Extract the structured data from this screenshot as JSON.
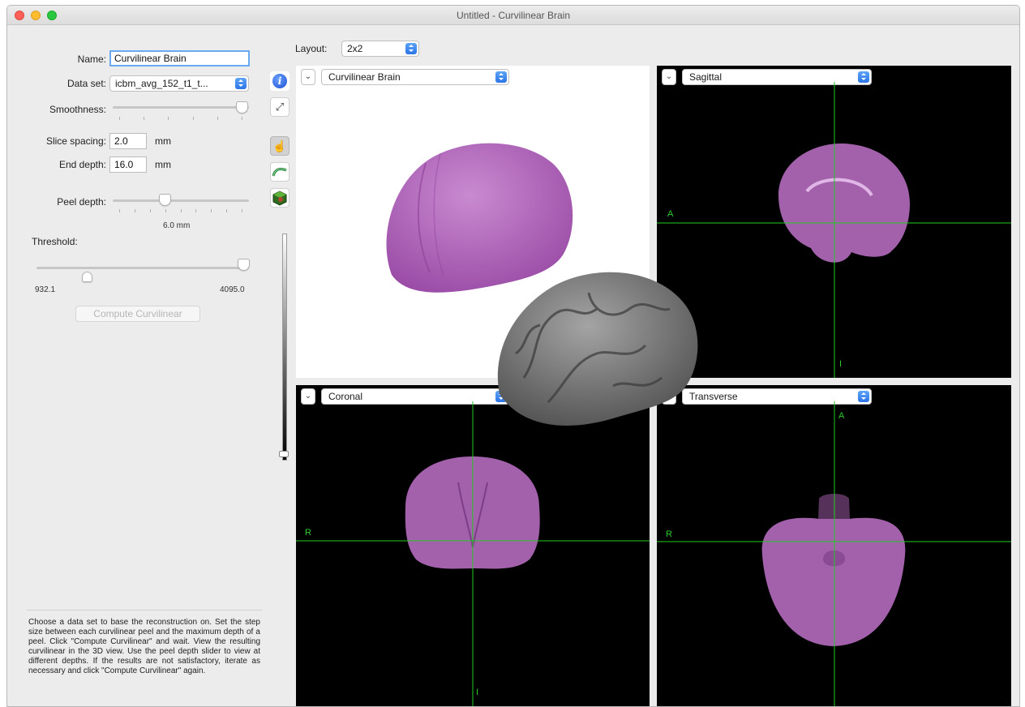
{
  "window": {
    "title": "Untitled - Curvilinear Brain"
  },
  "form": {
    "name_label": "Name:",
    "name_value": "Curvilinear Brain",
    "dataset_label": "Data set:",
    "dataset_value": "icbm_avg_152_t1_t...",
    "smoothness_label": "Smoothness:",
    "smoothness_level": 1.0,
    "slice_spacing_label": "Slice spacing:",
    "slice_spacing_value": "2.0",
    "slice_spacing_unit": "mm",
    "end_depth_label": "End depth:",
    "end_depth_value": "16.0",
    "end_depth_unit": "mm",
    "peel_depth_label": "Peel depth:",
    "peel_depth_value": "6.0 mm",
    "threshold_label": "Threshold:",
    "threshold_min": "932.1",
    "threshold_max": "4095.0",
    "compute_button": "Compute Curvilinear",
    "help_text": "Choose a data set to base the reconstruction on. Set the step size between each curvilinear peel and the maximum depth of a peel. Click \"Compute Curvilinear\" and wait. View the resulting curvilinear in the 3D view. Use the peel depth slider to view at different depths. If the results are not satisfactory, iterate as necessary and click \"Compute Curvilinear\" again."
  },
  "toolbar": {
    "info_icon": "info-icon",
    "expand_icon": "expand-icon",
    "pointer_icon": "pointer-hand-icon",
    "peel_icon": "curvilinear-peel-icon",
    "cube_icon": "volume-cube-icon"
  },
  "layout": {
    "label": "Layout:",
    "value": "2x2"
  },
  "panes": {
    "top_left": "Curvilinear Brain",
    "top_right": "Sagittal",
    "bottom_left": "Coronal",
    "bottom_right": "Transverse"
  },
  "orientation": {
    "anterior": "A",
    "inferior": "I",
    "right": "R"
  },
  "colors": {
    "brain_surface": "#b56bbf",
    "crosshair": "#22cc22",
    "accent_blue": "#2b75e6"
  }
}
